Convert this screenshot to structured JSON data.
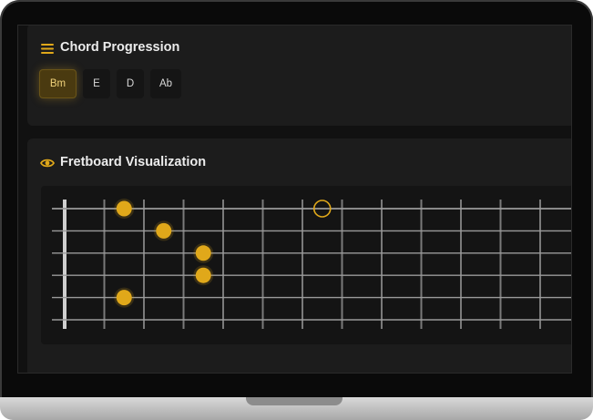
{
  "chords_panel": {
    "title": "Chord Progression",
    "icon": "menu-lines-icon",
    "chords": [
      "Bm",
      "E",
      "D",
      "Ab"
    ],
    "active_index": 0
  },
  "fretboard_panel": {
    "title": "Fretboard Visualization",
    "icon": "eye-icon",
    "strings": 6,
    "frets_visible": 13,
    "dots": [
      {
        "string": 1,
        "fret": 2,
        "style": "filled"
      },
      {
        "string": 1,
        "fret": 7,
        "style": "open-ring"
      },
      {
        "string": 2,
        "fret": 3,
        "style": "filled"
      },
      {
        "string": 3,
        "fret": 4,
        "style": "filled"
      },
      {
        "string": 4,
        "fret": 4,
        "style": "filled"
      },
      {
        "string": 5,
        "fret": 2,
        "style": "filled"
      }
    ]
  },
  "colors": {
    "accent": "#e0a81a",
    "screen_bg": "#111111",
    "panel_bg": "#1c1c1c",
    "string_color": "#9a9a9a",
    "nut_color": "#cfcfcf"
  }
}
